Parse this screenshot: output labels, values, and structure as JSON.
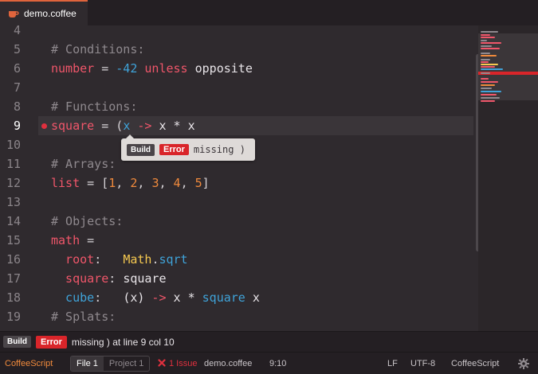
{
  "tab": {
    "label": "demo.coffee",
    "icon": "coffee-icon"
  },
  "editor": {
    "line_numbers": [
      "4",
      "5",
      "6",
      "7",
      "8",
      "9",
      "10",
      "11",
      "12",
      "13",
      "14",
      "15",
      "16",
      "17",
      "18",
      "19"
    ],
    "active_line": "9",
    "lines": [
      [],
      [
        {
          "t": "# Conditions:",
          "c": "comment"
        }
      ],
      [
        {
          "t": "number",
          "c": "var"
        },
        {
          "t": " = ",
          "c": "op"
        },
        {
          "t": "-42",
          "c": "numblue"
        },
        {
          "t": " unless ",
          "c": "kw"
        },
        {
          "t": "opposite",
          "c": "plain"
        }
      ],
      [],
      [
        {
          "t": "# Functions:",
          "c": "comment"
        }
      ],
      [
        {
          "t": "square",
          "c": "var"
        },
        {
          "t": " = (",
          "c": "op"
        },
        {
          "t": "x",
          "c": "fn"
        },
        {
          "t": " -> ",
          "c": "arrow"
        },
        {
          "t": "x * x",
          "c": "plain"
        }
      ],
      [],
      [
        {
          "t": "# Arrays:",
          "c": "comment"
        }
      ],
      [
        {
          "t": "list",
          "c": "var"
        },
        {
          "t": " = [",
          "c": "op"
        },
        {
          "t": "1",
          "c": "num"
        },
        {
          "t": ", ",
          "c": "op"
        },
        {
          "t": "2",
          "c": "num"
        },
        {
          "t": ", ",
          "c": "op"
        },
        {
          "t": "3",
          "c": "num"
        },
        {
          "t": ", ",
          "c": "op"
        },
        {
          "t": "4",
          "c": "num"
        },
        {
          "t": ", ",
          "c": "op"
        },
        {
          "t": "5",
          "c": "num"
        },
        {
          "t": "]",
          "c": "op"
        }
      ],
      [],
      [
        {
          "t": "# Objects:",
          "c": "comment"
        }
      ],
      [
        {
          "t": "math",
          "c": "var"
        },
        {
          "t": " =",
          "c": "op"
        }
      ],
      [
        {
          "t": "  root",
          "c": "var"
        },
        {
          "t": ":   ",
          "c": "op"
        },
        {
          "t": "Math",
          "c": "cls"
        },
        {
          "t": ".",
          "c": "op"
        },
        {
          "t": "sqrt",
          "c": "fn"
        }
      ],
      [
        {
          "t": "  square",
          "c": "var"
        },
        {
          "t": ": ",
          "c": "op"
        },
        {
          "t": "square",
          "c": "plain"
        }
      ],
      [
        {
          "t": "  cube",
          "c": "fn"
        },
        {
          "t": ":   ",
          "c": "op"
        },
        {
          "t": "(x)",
          "c": "plain"
        },
        {
          "t": " -> ",
          "c": "arrow"
        },
        {
          "t": "x * ",
          "c": "plain"
        },
        {
          "t": "square",
          "c": "fn"
        },
        {
          "t": " x",
          "c": "plain"
        }
      ],
      [
        {
          "t": "# Splats:",
          "c": "comment"
        }
      ]
    ]
  },
  "tooltip": {
    "build": "Build",
    "error": "Error",
    "message": "missing )"
  },
  "error_panel": {
    "build": "Build",
    "error": "Error",
    "message": "missing ) at line 9 col 10"
  },
  "status": {
    "grammar_left": "CoffeeScript",
    "tab_file": "File",
    "tab_file_count": "1",
    "tab_project": "Project",
    "tab_project_count": "1",
    "issues": "1 Issue",
    "filename": "demo.coffee",
    "cursor": "9:10",
    "line_ending": "LF",
    "encoding": "UTF-8",
    "grammar": "CoffeeScript",
    "settings_icon": "gear-icon"
  },
  "colors": {
    "accent": "#e0643c",
    "error": "#d9252a"
  }
}
